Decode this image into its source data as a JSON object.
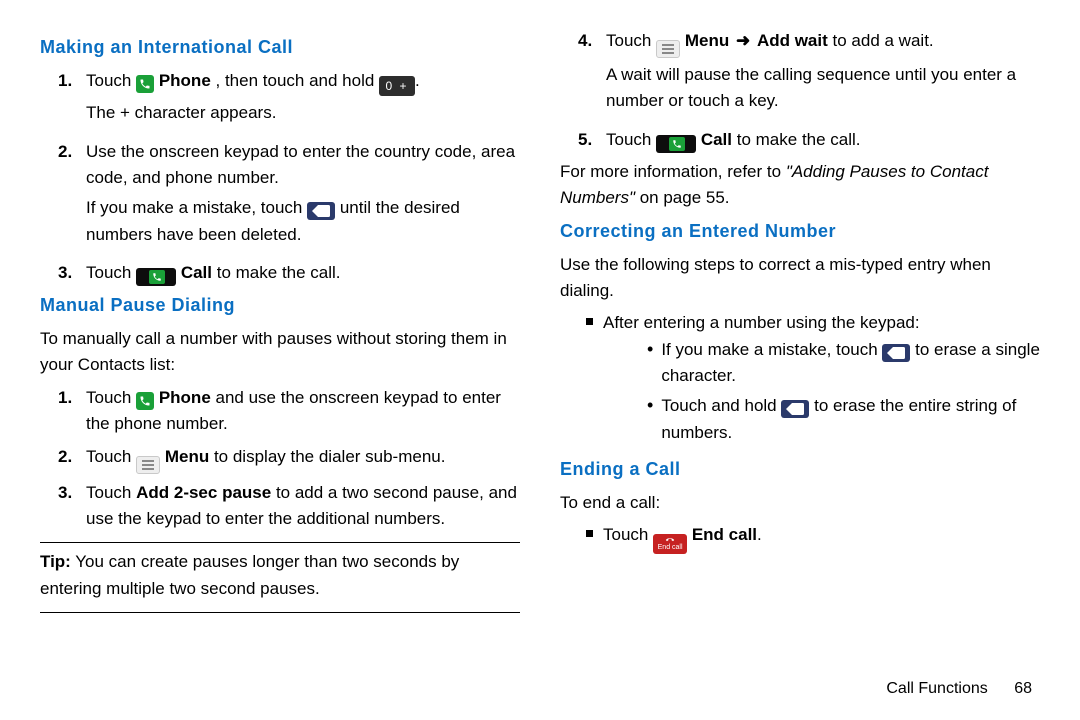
{
  "left": {
    "h_intl": "Making an International Call",
    "intl": {
      "s1a": "Touch ",
      "s1b": " Phone",
      "s1c": ", then touch and hold ",
      "s1d": ".",
      "s1e": "The + character appears.",
      "s2": "Use the onscreen keypad to enter the country code, area code, and phone number.",
      "s2b1": "If you make a mistake, touch ",
      "s2b2": " until the desired numbers have been deleted.",
      "s3a": "Touch ",
      "s3b": " Call",
      "s3c": " to make the call."
    },
    "h_pause": "Manual Pause Dialing",
    "pause_intro": "To manually call a number with pauses without storing them in your Contacts list:",
    "pause": {
      "s1a": "Touch ",
      "s1b": " Phone",
      "s1c": " and use the onscreen keypad to enter the phone number.",
      "s2a": "Touch ",
      "s2b": " Menu",
      "s2c": " to display the dialer sub-menu.",
      "s3a": "Touch ",
      "s3b": "Add 2-sec pause",
      "s3c": " to add a two second pause, and use the keypad to enter the additional numbers."
    },
    "tip_label": "Tip:",
    "tip_text": " You can create pauses longer than two seconds by entering multiple two second pauses."
  },
  "right": {
    "cont": {
      "s4a": "Touch ",
      "s4b": " Menu",
      "s4arrow": " ",
      "s4c": " Add wait",
      "s4d": " to add a wait.",
      "s4e": "A wait will pause the calling sequence until you enter a number or touch a key.",
      "s5a": "Touch ",
      "s5b": " Call",
      "s5c": " to make the call."
    },
    "ref1": "For more information, refer to ",
    "ref2": "\"Adding Pauses to Contact Numbers\"",
    "ref3": " on page 55.",
    "h_correct": "Correcting an Entered Number",
    "correct_intro": "Use the following steps to correct a mis-typed entry when dialing.",
    "bullet1": "After entering a number using the keypad:",
    "sb1a": "If you make a mistake, touch ",
    "sb1b": " to erase a single character.",
    "sb2a": "Touch and hold ",
    "sb2b": " to erase the entire string of numbers.",
    "h_end": "Ending a Call",
    "end_intro": "To end a call:",
    "end1a": "Touch ",
    "end1b": " End call",
    "end1c": "."
  },
  "icons": {
    "zero_label": "0 +",
    "endcall_label": "End call"
  },
  "footer": {
    "section": "Call Functions",
    "page": "68"
  }
}
